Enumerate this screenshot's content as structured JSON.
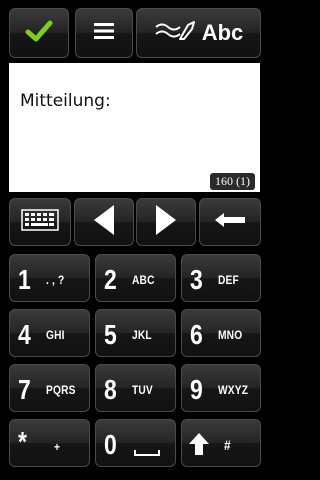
{
  "toolbar": {
    "confirm_icon": "checkmark-icon",
    "menu_icon": "menu-icon",
    "input_mode_icon": "handwriting-icon",
    "input_mode_label": "Abc"
  },
  "editor": {
    "prompt": "Mitteilung:",
    "char_counter": "160 (1)"
  },
  "controls": {
    "keyboard_icon": "keyboard-icon",
    "left_icon": "arrow-left-icon",
    "right_icon": "arrow-right-icon",
    "backspace_icon": "backspace-icon"
  },
  "keypad": {
    "keys": [
      {
        "digit": "1",
        "letters": ". , ?"
      },
      {
        "digit": "2",
        "letters": "ABC"
      },
      {
        "digit": "3",
        "letters": "DEF"
      },
      {
        "digit": "4",
        "letters": "GHI"
      },
      {
        "digit": "5",
        "letters": "JKL"
      },
      {
        "digit": "6",
        "letters": "MNO"
      },
      {
        "digit": "7",
        "letters": "PQRS"
      },
      {
        "digit": "8",
        "letters": "TUV"
      },
      {
        "digit": "9",
        "letters": "WXYZ"
      },
      {
        "digit": "*",
        "letters": "+"
      },
      {
        "digit": "0",
        "letters": "space-icon"
      },
      {
        "digit": "shift-icon",
        "letters": "#"
      }
    ]
  },
  "colors": {
    "background": "#000000",
    "accent_check": "#7ccf1f",
    "text_area": "#ffffff"
  }
}
